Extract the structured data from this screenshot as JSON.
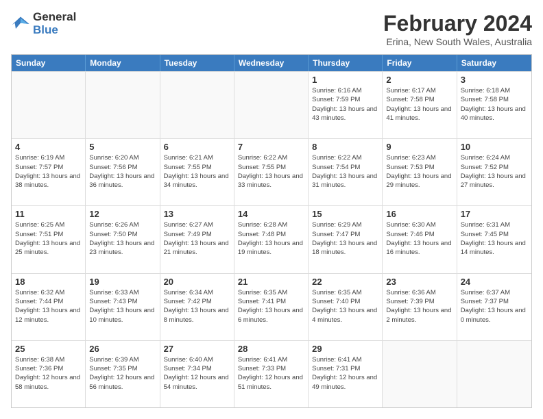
{
  "logo": {
    "line1": "General",
    "line2": "Blue"
  },
  "title": "February 2024",
  "subtitle": "Erina, New South Wales, Australia",
  "headers": [
    "Sunday",
    "Monday",
    "Tuesday",
    "Wednesday",
    "Thursday",
    "Friday",
    "Saturday"
  ],
  "rows": [
    [
      {
        "day": "",
        "info": ""
      },
      {
        "day": "",
        "info": ""
      },
      {
        "day": "",
        "info": ""
      },
      {
        "day": "",
        "info": ""
      },
      {
        "day": "1",
        "info": "Sunrise: 6:16 AM\nSunset: 7:59 PM\nDaylight: 13 hours and 43 minutes."
      },
      {
        "day": "2",
        "info": "Sunrise: 6:17 AM\nSunset: 7:58 PM\nDaylight: 13 hours and 41 minutes."
      },
      {
        "day": "3",
        "info": "Sunrise: 6:18 AM\nSunset: 7:58 PM\nDaylight: 13 hours and 40 minutes."
      }
    ],
    [
      {
        "day": "4",
        "info": "Sunrise: 6:19 AM\nSunset: 7:57 PM\nDaylight: 13 hours and 38 minutes."
      },
      {
        "day": "5",
        "info": "Sunrise: 6:20 AM\nSunset: 7:56 PM\nDaylight: 13 hours and 36 minutes."
      },
      {
        "day": "6",
        "info": "Sunrise: 6:21 AM\nSunset: 7:55 PM\nDaylight: 13 hours and 34 minutes."
      },
      {
        "day": "7",
        "info": "Sunrise: 6:22 AM\nSunset: 7:55 PM\nDaylight: 13 hours and 33 minutes."
      },
      {
        "day": "8",
        "info": "Sunrise: 6:22 AM\nSunset: 7:54 PM\nDaylight: 13 hours and 31 minutes."
      },
      {
        "day": "9",
        "info": "Sunrise: 6:23 AM\nSunset: 7:53 PM\nDaylight: 13 hours and 29 minutes."
      },
      {
        "day": "10",
        "info": "Sunrise: 6:24 AM\nSunset: 7:52 PM\nDaylight: 13 hours and 27 minutes."
      }
    ],
    [
      {
        "day": "11",
        "info": "Sunrise: 6:25 AM\nSunset: 7:51 PM\nDaylight: 13 hours and 25 minutes."
      },
      {
        "day": "12",
        "info": "Sunrise: 6:26 AM\nSunset: 7:50 PM\nDaylight: 13 hours and 23 minutes."
      },
      {
        "day": "13",
        "info": "Sunrise: 6:27 AM\nSunset: 7:49 PM\nDaylight: 13 hours and 21 minutes."
      },
      {
        "day": "14",
        "info": "Sunrise: 6:28 AM\nSunset: 7:48 PM\nDaylight: 13 hours and 19 minutes."
      },
      {
        "day": "15",
        "info": "Sunrise: 6:29 AM\nSunset: 7:47 PM\nDaylight: 13 hours and 18 minutes."
      },
      {
        "day": "16",
        "info": "Sunrise: 6:30 AM\nSunset: 7:46 PM\nDaylight: 13 hours and 16 minutes."
      },
      {
        "day": "17",
        "info": "Sunrise: 6:31 AM\nSunset: 7:45 PM\nDaylight: 13 hours and 14 minutes."
      }
    ],
    [
      {
        "day": "18",
        "info": "Sunrise: 6:32 AM\nSunset: 7:44 PM\nDaylight: 13 hours and 12 minutes."
      },
      {
        "day": "19",
        "info": "Sunrise: 6:33 AM\nSunset: 7:43 PM\nDaylight: 13 hours and 10 minutes."
      },
      {
        "day": "20",
        "info": "Sunrise: 6:34 AM\nSunset: 7:42 PM\nDaylight: 13 hours and 8 minutes."
      },
      {
        "day": "21",
        "info": "Sunrise: 6:35 AM\nSunset: 7:41 PM\nDaylight: 13 hours and 6 minutes."
      },
      {
        "day": "22",
        "info": "Sunrise: 6:35 AM\nSunset: 7:40 PM\nDaylight: 13 hours and 4 minutes."
      },
      {
        "day": "23",
        "info": "Sunrise: 6:36 AM\nSunset: 7:39 PM\nDaylight: 13 hours and 2 minutes."
      },
      {
        "day": "24",
        "info": "Sunrise: 6:37 AM\nSunset: 7:37 PM\nDaylight: 13 hours and 0 minutes."
      }
    ],
    [
      {
        "day": "25",
        "info": "Sunrise: 6:38 AM\nSunset: 7:36 PM\nDaylight: 12 hours and 58 minutes."
      },
      {
        "day": "26",
        "info": "Sunrise: 6:39 AM\nSunset: 7:35 PM\nDaylight: 12 hours and 56 minutes."
      },
      {
        "day": "27",
        "info": "Sunrise: 6:40 AM\nSunset: 7:34 PM\nDaylight: 12 hours and 54 minutes."
      },
      {
        "day": "28",
        "info": "Sunrise: 6:41 AM\nSunset: 7:33 PM\nDaylight: 12 hours and 51 minutes."
      },
      {
        "day": "29",
        "info": "Sunrise: 6:41 AM\nSunset: 7:31 PM\nDaylight: 12 hours and 49 minutes."
      },
      {
        "day": "",
        "info": ""
      },
      {
        "day": "",
        "info": ""
      }
    ]
  ]
}
